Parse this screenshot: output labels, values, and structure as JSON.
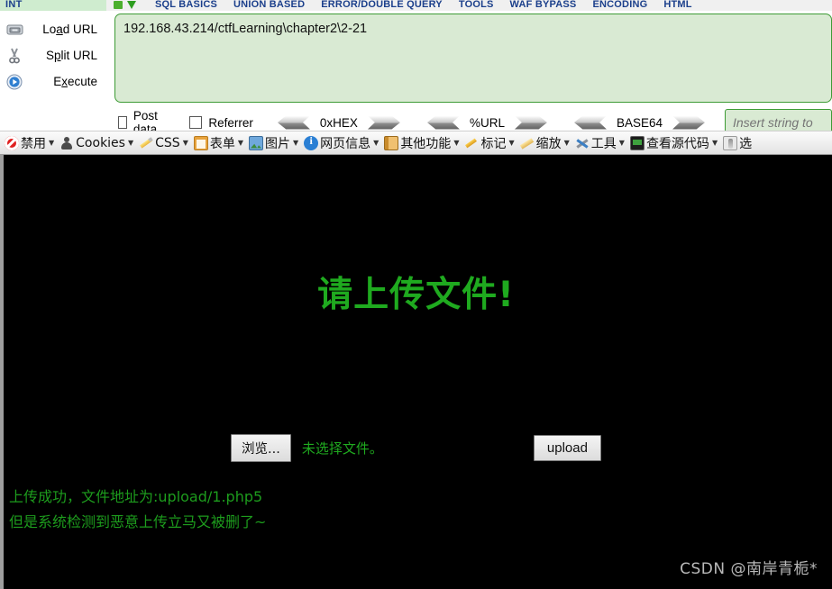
{
  "hackbar": {
    "menu": {
      "int_tab": "INT",
      "icons": [
        "green-square-icon",
        "green-arrow-down-icon"
      ],
      "items": [
        "SQL BASICS",
        "UNION BASED",
        "ERROR/DOUBLE QUERY",
        "TOOLS",
        "WAF BYPASS",
        "ENCODING",
        "HTML"
      ]
    },
    "actions": [
      {
        "icon": "load-url-icon",
        "label_pre": "Lo",
        "label_key": "a",
        "label_post": "d URL"
      },
      {
        "icon": "scissors-icon",
        "label_pre": "S",
        "label_key": "p",
        "label_post": "lit URL"
      },
      {
        "icon": "execute-icon",
        "label_pre": "E",
        "label_key": "x",
        "label_post": "ecute"
      }
    ],
    "url_value": "192.168.43.214/ctfLearning\\chapter2\\2-21",
    "checkboxes": [
      {
        "label": "Post data",
        "checked": false
      },
      {
        "label": "Referrer",
        "checked": false
      }
    ],
    "converters": [
      "0xHEX",
      "%URL",
      "BASE64"
    ],
    "insert_placeholder": "Insert string to ",
    "insert_value": ""
  },
  "cn_toolbar": {
    "items": [
      {
        "icon": "ban-icon",
        "label": "禁用",
        "caret": "▼"
      },
      {
        "icon": "person-icon",
        "label": "Cookies",
        "caret": "▼"
      },
      {
        "icon": "pen-icon",
        "label": "CSS",
        "caret": "▼"
      },
      {
        "icon": "clipboard-icon",
        "label": "表单",
        "caret": "▼"
      },
      {
        "icon": "image-icon",
        "label": "图片",
        "caret": "▼"
      },
      {
        "icon": "info-icon",
        "label": "网页信息",
        "caret": "▼"
      },
      {
        "icon": "book-icon",
        "label": "其他功能",
        "caret": "▼"
      },
      {
        "icon": "marker-icon",
        "label": "标记",
        "caret": "▼"
      },
      {
        "icon": "ruler-icon",
        "label": "缩放",
        "caret": "▼"
      },
      {
        "icon": "tools-icon",
        "label": "工具",
        "caret": "▼"
      },
      {
        "icon": "source-icon",
        "label": "查看源代码",
        "caret": "▼"
      },
      {
        "icon": "options-icon",
        "label": "选",
        "caret": ""
      }
    ]
  },
  "page": {
    "headline": "请上传文件!",
    "file_button": "浏览...",
    "file_status": "未选择文件。",
    "upload_button": "upload",
    "messages": [
      "上传成功，文件地址为:upload/1.php5",
      "但是系统检测到恶意上传立马又被删了~"
    ],
    "watermark": "CSDN @南岸青栀*",
    "colors": {
      "background": "#000000",
      "text_green": "#1faa1f",
      "watermark": "#b9b9b9",
      "hackbar_field": "#d9ead3",
      "hackbar_border": "#3d9b35"
    }
  }
}
